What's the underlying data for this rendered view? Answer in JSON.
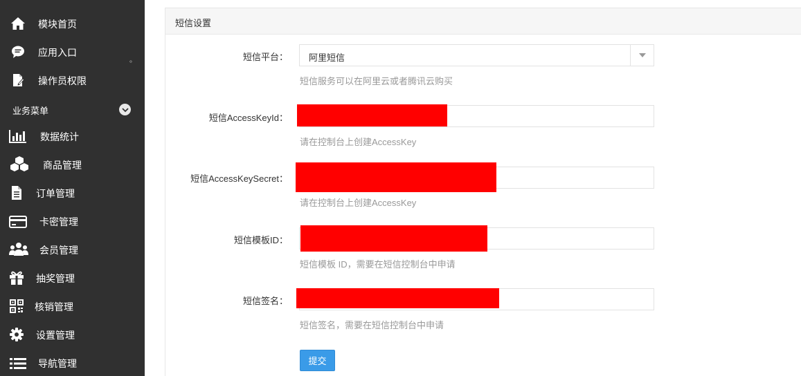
{
  "sidebar": {
    "items": [
      {
        "label": "模块首页",
        "icon": "home-icon"
      },
      {
        "label": "应用入口",
        "icon": "chat-icon"
      },
      {
        "label": "操作员权限",
        "icon": "document-edit-icon"
      }
    ],
    "section": {
      "label": "业务菜单",
      "toggle_icon": "chevron-down-icon"
    },
    "business_items": [
      {
        "label": "数据统计",
        "icon": "bar-chart-icon"
      },
      {
        "label": "商品管理",
        "icon": "cubes-icon"
      },
      {
        "label": "订单管理",
        "icon": "file-text-icon"
      },
      {
        "label": "卡密管理",
        "icon": "credit-card-icon"
      },
      {
        "label": "会员管理",
        "icon": "users-icon"
      },
      {
        "label": "抽奖管理",
        "icon": "gift-icon"
      },
      {
        "label": "核销管理",
        "icon": "qrcode-icon"
      },
      {
        "label": "设置管理",
        "icon": "gear-icon"
      },
      {
        "label": "导航管理",
        "icon": "list-icon"
      }
    ],
    "dot": "。"
  },
  "panel": {
    "title": "短信设置"
  },
  "form": {
    "platform": {
      "label": "短信平台：",
      "value": "阿里短信",
      "help": "短信服务可以在阿里云或者腾讯云购买"
    },
    "access_key_id": {
      "label": "短信AccessKeyId：",
      "help": "请在控制台上创建AccessKey"
    },
    "access_key_secret": {
      "label": "短信AccessKeySecret：",
      "help": "请在控制台上创建AccessKey"
    },
    "template_id": {
      "label": "短信模板ID：",
      "help": "短信模板 ID，需要在短信控制台中申请"
    },
    "signature": {
      "label": "短信签名：",
      "help": "短信签名，需要在短信控制台中申请"
    },
    "submit_label": "提交"
  },
  "colors": {
    "sidebar_bg": "#303030",
    "redaction": "#ff0000",
    "primary_button": "#3a9be8"
  }
}
